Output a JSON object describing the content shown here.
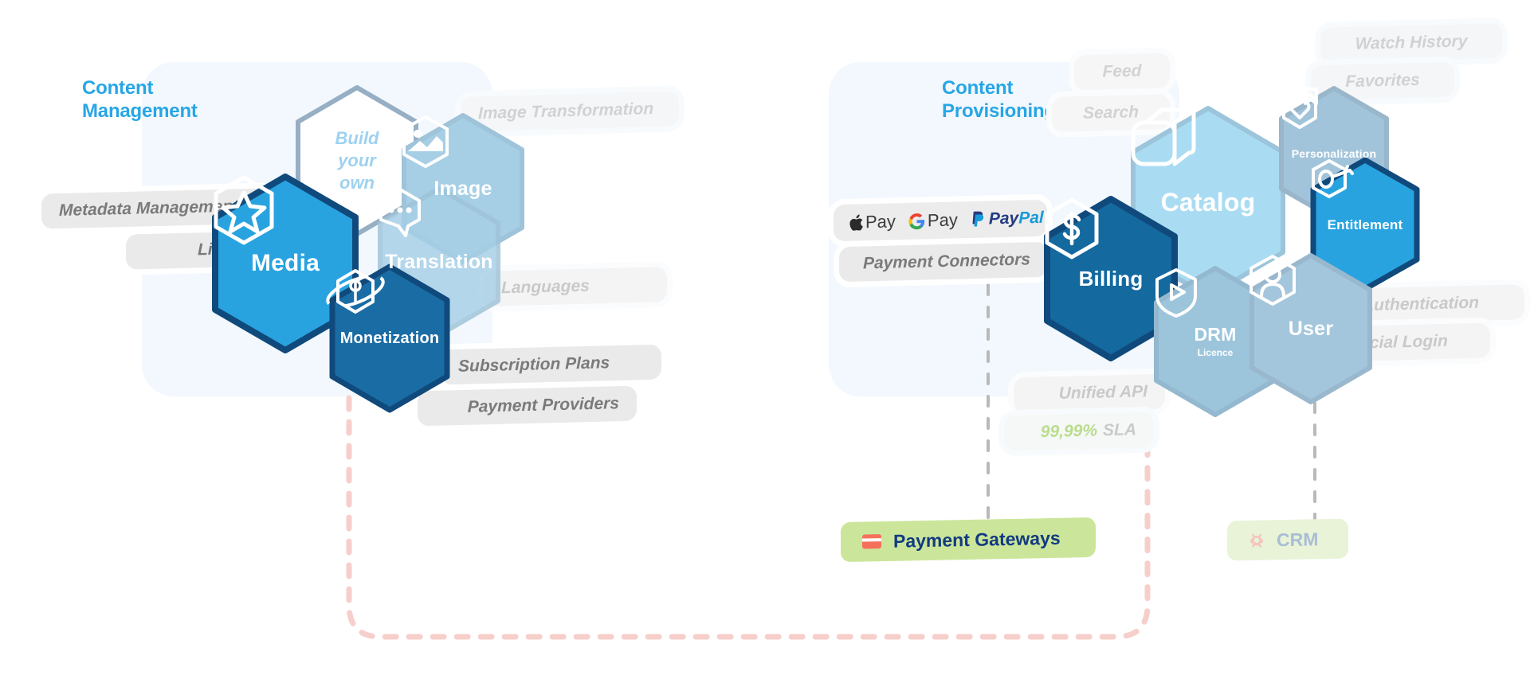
{
  "sections": {
    "left": {
      "title": "Content\nManagement"
    },
    "right": {
      "title": "Content\nProvisioning"
    }
  },
  "left_tags": [
    {
      "label": "Metadata Management"
    },
    {
      "label": "Licensing"
    },
    {
      "label": "Image Transformation"
    },
    {
      "label": "Languages"
    },
    {
      "label": "Subscription Plans"
    },
    {
      "label": "Payment Providers"
    }
  ],
  "right_tags": [
    {
      "label": "Feed"
    },
    {
      "label": "Search"
    },
    {
      "label": "Watch History"
    },
    {
      "label": "Favorites"
    },
    {
      "label": "Payment Connectors"
    },
    {
      "label": "Authentication"
    },
    {
      "label": "Social Login"
    },
    {
      "label": "Unified API"
    }
  ],
  "sla": {
    "value": "99,99%",
    "label": "SLA",
    "value_color": "#b9dd8b"
  },
  "payment_logos": [
    {
      "name": "apple-pay",
      "text": "Pay"
    },
    {
      "name": "google-pay",
      "text": "Pay"
    },
    {
      "name": "paypal",
      "text_a": "Pay",
      "text_b": "Pal"
    }
  ],
  "hexagons": {
    "build_your_own": {
      "label": "Build\nyour\nown",
      "fill": "#ffffff",
      "stroke": "#97afc4",
      "text_color": "#9ed2ef"
    },
    "media": {
      "label": "Media",
      "icon": "star-badge-icon",
      "fill": "#29a3e0",
      "stroke": "#104a7c"
    },
    "image": {
      "label": "Image",
      "icon": "photo-icon",
      "fill": "#a6cfe6",
      "stroke": "#9fc3d9"
    },
    "translation": {
      "label": "Translation",
      "icon": "chat-bubble-icon",
      "fill": "#a6cfe6",
      "stroke": "#9fc3d9"
    },
    "monetization": {
      "label": "Monetization",
      "icon": "dollar-orbit-icon",
      "fill": "#1a6ca4",
      "stroke": "#104a7c"
    },
    "catalog": {
      "label": "Catalog",
      "icon": "box-stack-icon",
      "fill": "#a9dcf2",
      "stroke": "#9cc4da"
    },
    "personalization": {
      "label": "Personalization",
      "icon": "heart-bookmark-icon",
      "fill": "#a2c4da",
      "stroke": "#9ab6ca"
    },
    "entitlement": {
      "label": "Entitlement",
      "icon": "key-icon",
      "fill": "#29a3e0",
      "stroke": "#104a7c"
    },
    "billing": {
      "label": "Billing",
      "icon": "dollar-hex-icon",
      "fill": "#14699f",
      "stroke": "#104a7c"
    },
    "drm": {
      "label": "DRM",
      "sublabel": "Licence",
      "icon": "play-shield-icon",
      "fill": "#9cc5dc",
      "stroke": "#93b8cf"
    },
    "user": {
      "label": "User",
      "icon": "person-icon",
      "fill": "#a4c6dc",
      "stroke": "#9ab8cd"
    }
  },
  "chips": [
    {
      "label": "Payment Gateways",
      "icon": "credit-card-icon",
      "style": "green"
    },
    {
      "label": "CRM",
      "icon": "crm-icon",
      "style": "palegreen"
    }
  ],
  "colors": {
    "accent": "#27a6e5",
    "panel": "#f2f8fd",
    "chip_green": "#cbe69a",
    "chip_pale": "#e8f3d8",
    "dash_pink": "#f6cfcb",
    "dash_grey": "#b9b9b9",
    "deep_navy": "#123a80"
  }
}
